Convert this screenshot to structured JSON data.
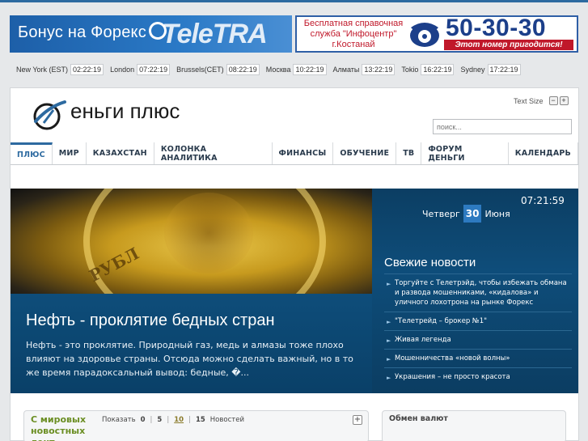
{
  "banners": {
    "left_text": "Бонус на Форекс",
    "left_brand": "TeleTRA",
    "right_ad_line1": "Бесплатная справочная",
    "right_ad_line2": "служба \"Инфоцентр\"",
    "right_ad_line3": "г.Костанай",
    "right_phone": "50-30-30",
    "right_slogan": "Этот номер пригодится!"
  },
  "clocks": [
    {
      "city": "New York (EST)",
      "time": "02:22:19"
    },
    {
      "city": "London",
      "time": "07:22:19"
    },
    {
      "city": "Brussels(CET)",
      "time": "08:22:19"
    },
    {
      "city": "Москва",
      "time": "10:22:19"
    },
    {
      "city": "Алматы",
      "time": "13:22:19"
    },
    {
      "city": "Tokio",
      "time": "16:22:19"
    },
    {
      "city": "Sydney",
      "time": "17:22:19"
    }
  ],
  "header": {
    "logo_word": "еньги плюс",
    "text_size_label": "Text Size",
    "minus": "−",
    "plus": "+",
    "search_placeholder": "поиск..."
  },
  "nav": [
    "ПЛЮС",
    "МИР",
    "КАЗАХСТАН",
    "КОЛОНКА АНАЛИТИКА",
    "ФИНАНСЫ",
    "ОБУЧЕНИЕ",
    "ТВ",
    "ФОРУМ ДЕНЬГИ",
    "КАЛЕНДАРЬ"
  ],
  "hero": {
    "coin_text": "РУБЛ",
    "title": "Нефть - проклятие бедных стран",
    "excerpt": "Нефть - это проклятие. Природный газ, медь и алмазы тоже плохо влияют на здоровье страны. Отсюда можно сделать важный, но в то же время парадоксальный вывод: бедные, �..."
  },
  "panel": {
    "time": "07:21:59",
    "weekday": "Четверг",
    "day": "30",
    "month": "Июня",
    "news_heading": "Свежие новости",
    "news": [
      "Торгуйте с Телетрэйд, чтобы избежать обмана и развода мошенниками, «кидалова» и уличного лохотрона на рынке Форекс",
      "\"Телетрейд – брокер №1\"",
      "Живая легенда",
      "Мошенничества «новой волны»",
      "Украшения – не просто красота"
    ]
  },
  "box_left": {
    "title": "С мировых новостных лент",
    "show_label": "Показать",
    "options": [
      "0",
      "5",
      "10",
      "15"
    ],
    "selected": "10",
    "suffix": "Новостей",
    "expand": "+"
  },
  "box_right": {
    "title": "Обмен валют"
  },
  "colors": {
    "accent": "#2d6aa0",
    "panel_bg": "#0e4d7a",
    "green_title": "#6b8e23"
  }
}
